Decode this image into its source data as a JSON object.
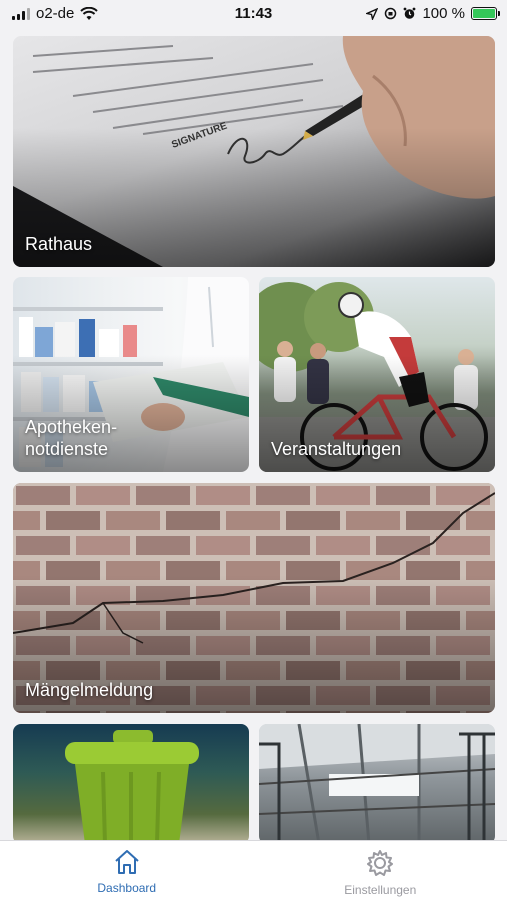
{
  "status_bar": {
    "carrier": "o2-de",
    "time": "11:43",
    "battery": "100 %"
  },
  "tiles": {
    "rathaus": {
      "label": "Rathaus",
      "signature_text": "SIGNATURE"
    },
    "apotheke": {
      "label": "Apotheken-\nnotdienste"
    },
    "veranstaltungen": {
      "label": "Veranstaltungen"
    },
    "maengel": {
      "label": "Mängelmeldung"
    },
    "abfall": {
      "label": ""
    },
    "halle": {
      "label": ""
    }
  },
  "tab_bar": {
    "dashboard": "Dashboard",
    "settings": "Einstellungen"
  },
  "colors": {
    "accent": "#2f6db3",
    "inactive": "#9a9aa0",
    "battery": "#34c759"
  }
}
